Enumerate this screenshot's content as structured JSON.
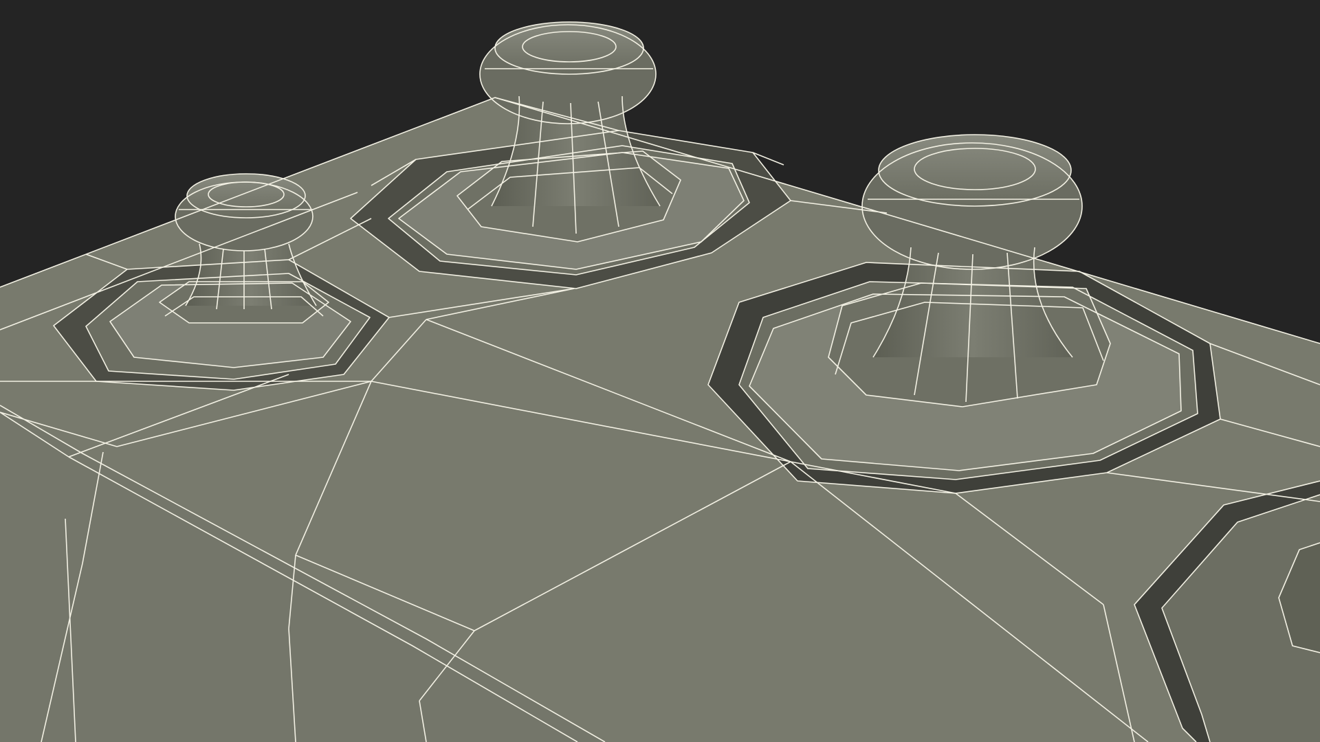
{
  "scene": {
    "subject": "wireframe-3d-model-top",
    "terminal_count": 3,
    "colors": {
      "background": "#242424",
      "surface": "#787a6d",
      "surface_light": "#81837a",
      "surface_dark": "#5f6155",
      "recess_shadow": "#3a3b34",
      "wire": "#f3f1e4"
    }
  }
}
